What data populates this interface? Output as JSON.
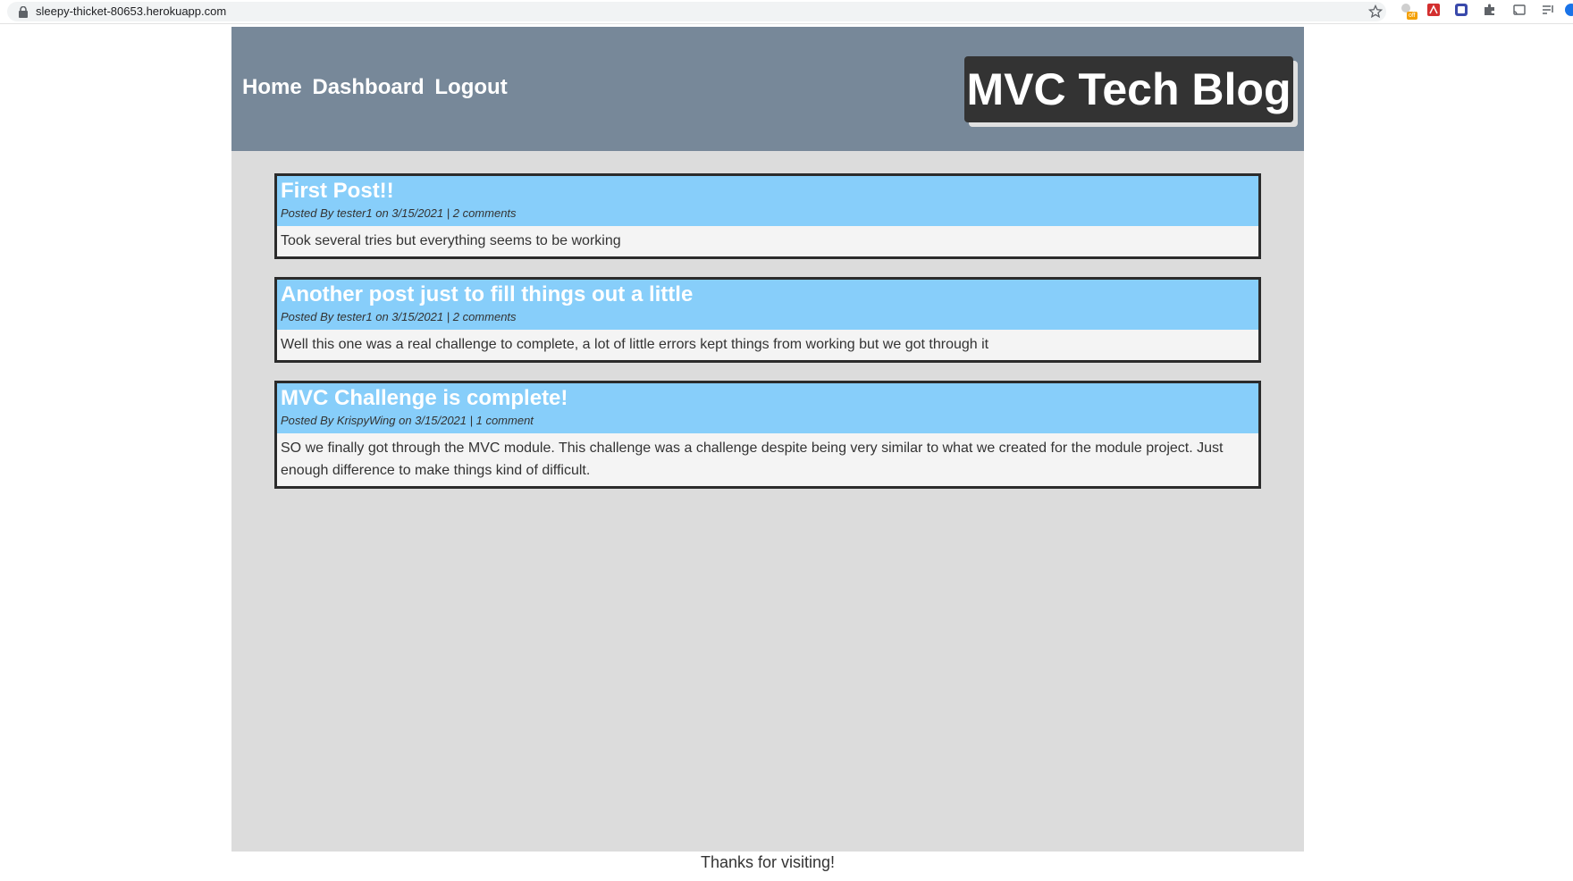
{
  "browser": {
    "url": "sleepy-thicket-80653.herokuapp.com",
    "extension_badge": "off"
  },
  "header": {
    "nav": [
      "Home",
      "Dashboard",
      "Logout"
    ],
    "logo": "MVC Tech Blog"
  },
  "posts": [
    {
      "title": "First Post!!",
      "meta": "Posted By tester1 on 3/15/2021 | 2 comments",
      "body": "Took several tries but everything seems to be working"
    },
    {
      "title": "Another post just to fill things out a little",
      "meta": "Posted By tester1 on 3/15/2021 | 2 comments",
      "body": "Well this one was a real challenge to complete, a lot of little errors kept things from working but we got through it"
    },
    {
      "title": "MVC Challenge is complete!",
      "meta": "Posted By KrispyWing on 3/15/2021 | 1 comment",
      "body": "SO we finally got through the MVC module. This challenge was a challenge despite being very similar to what we created for the module project. Just enough difference to make things kind of difficult."
    }
  ],
  "footer": {
    "text": "Thanks for visiting!"
  },
  "colors": {
    "header_bg": "#778899",
    "post_header_bg": "#87cefa",
    "logo_bg": "#333333",
    "page_bg": "#dcdcdc"
  }
}
